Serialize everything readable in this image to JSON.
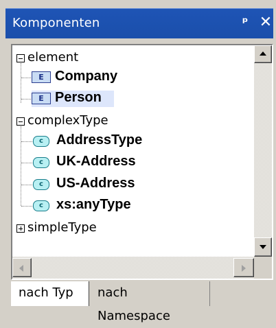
{
  "window": {
    "title": "Komponenten",
    "pin_glyph": "ਪ",
    "close_glyph": "✕"
  },
  "tree": {
    "element": {
      "label": "element",
      "children": [
        "Company",
        "Person"
      ],
      "icon_letter": "E",
      "selected": "Person"
    },
    "complexType": {
      "label": "complexType",
      "children": [
        "AddressType",
        "UK-Address",
        "US-Address",
        "xs:anyType"
      ],
      "icon_letter": "c"
    },
    "simpleType": {
      "label": "simpleType"
    }
  },
  "tabs": [
    "nach Typ",
    "nach Namespace"
  ],
  "active_tab": "nach Typ"
}
